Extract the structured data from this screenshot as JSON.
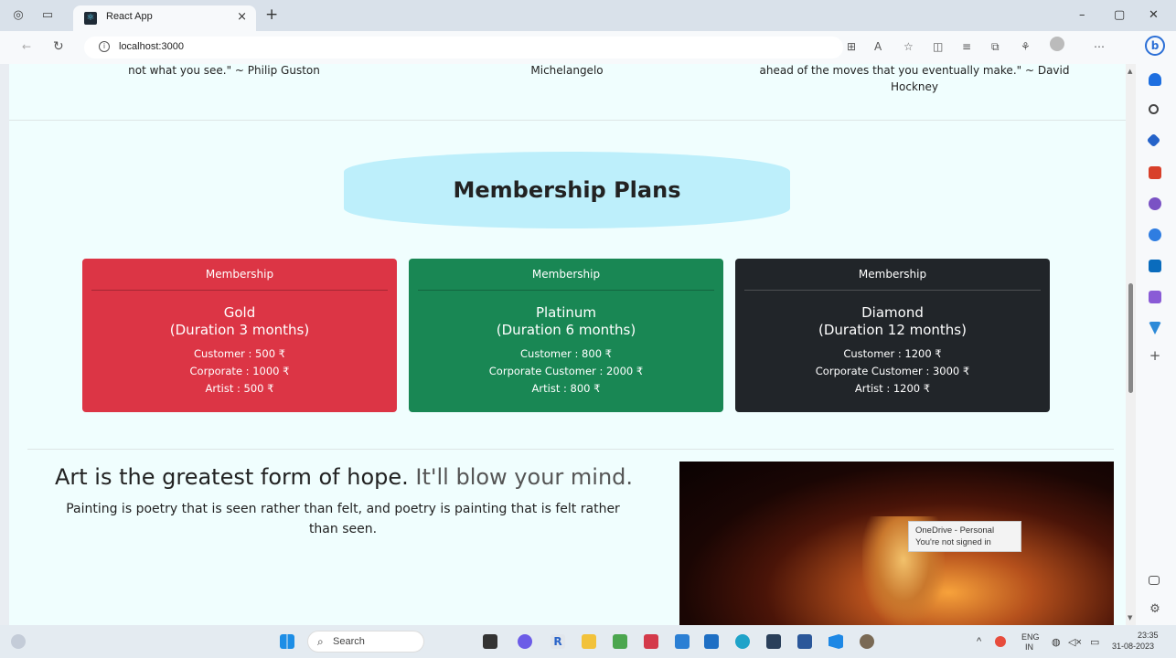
{
  "browser": {
    "tab_title": "React App",
    "close_tab": "×",
    "new_tab": "+",
    "url": "localhost:3000",
    "win_min": "–",
    "win_max": "▢",
    "win_close": "✕"
  },
  "quotes": {
    "left": "not what you see.\" ~ Philip Guston",
    "middle": "Michelangelo",
    "right_line1": "ahead of the moves that you eventually make.\" ~ David",
    "right_line2": "Hockney"
  },
  "membership": {
    "title": "Membership Plans",
    "cards": [
      {
        "header": "Membership",
        "name": "Gold",
        "duration": "(Duration 3 months)",
        "line1": "Customer : 500 ₹",
        "line2": "Corporate : 1000 ₹",
        "line3": "Artist : 500 ₹",
        "color": "#dc3545"
      },
      {
        "header": "Membership",
        "name": "Platinum",
        "duration": "(Duration 6 months)",
        "line1": "Customer : 800 ₹",
        "line2": "Corporate Customer : 2000 ₹",
        "line3": "Artist : 800 ₹",
        "color": "#198754"
      },
      {
        "header": "Membership",
        "name": "Diamond",
        "duration": "(Duration 12 months)",
        "line1": "Customer : 1200 ₹",
        "line2": "Corporate Customer : 3000 ₹",
        "line3": "Artist : 1200 ₹",
        "color": "#212529"
      }
    ]
  },
  "art": {
    "heading_main": "Art is the greatest form of hope.",
    "heading_sub": "It'll blow your mind.",
    "paragraph": "Painting is poetry that is seen rather than felt, and poetry is painting that is felt rather than seen."
  },
  "onedrive": {
    "line1": "OneDrive - Personal",
    "line2": "You're not signed in"
  },
  "taskbar": {
    "search_label": "Search",
    "lang_top": "ENG",
    "lang_bottom": "IN",
    "time": "23:35",
    "date": "31-08-2023"
  }
}
